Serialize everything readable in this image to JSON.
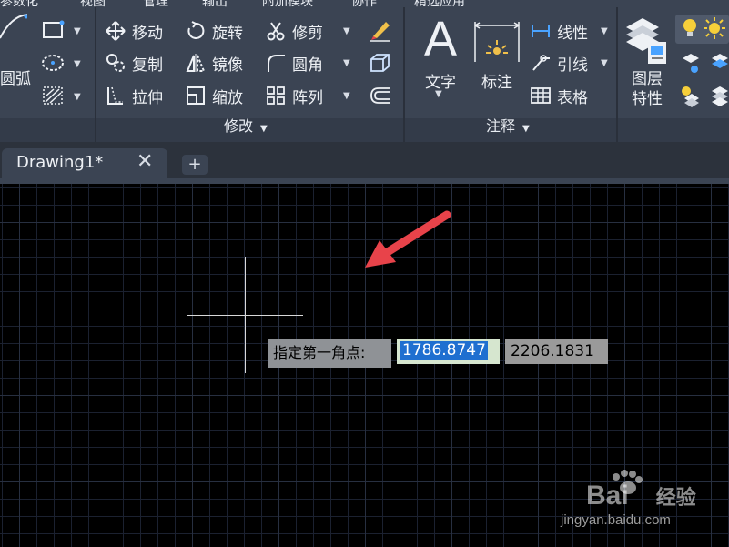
{
  "menu": {
    "items": [
      "参数化",
      "视图",
      "管理",
      "输出",
      "附加模块",
      "协作",
      "精选应用"
    ]
  },
  "ribbon": {
    "draw_panel": {
      "arc_label": "圆弧"
    },
    "modify_panel": {
      "title": "修改",
      "tools": [
        {
          "label": "移动",
          "icon": "move-icon"
        },
        {
          "label": "旋转",
          "icon": "rotate-icon"
        },
        {
          "label": "修剪",
          "icon": "trim-icon"
        },
        {
          "label": "复制",
          "icon": "copy-icon"
        },
        {
          "label": "镜像",
          "icon": "mirror-icon"
        },
        {
          "label": "圆角",
          "icon": "fillet-icon"
        },
        {
          "label": "拉伸",
          "icon": "stretch-icon"
        },
        {
          "label": "缩放",
          "icon": "scale-icon"
        },
        {
          "label": "阵列",
          "icon": "array-icon"
        }
      ]
    },
    "annotation_panel": {
      "title": "注释",
      "text_label": "文字",
      "dimension_label": "标注",
      "linear_label": "线性",
      "leader_label": "引线",
      "table_label": "表格"
    },
    "layers_panel": {
      "layer_properties_label": "图层\n特性",
      "line1": "图层",
      "line2": "特性"
    }
  },
  "tabs": {
    "document_tab": "Drawing1*",
    "close_symbol": "✕",
    "new_tab_symbol": "+"
  },
  "canvas": {
    "prompt": "指定第一角点:",
    "coord_x": "1786.8747",
    "coord_y": "2206.1831"
  },
  "watermark": {
    "brand": "Bai",
    "brand_suffix": "经验",
    "url": "jingyan.baidu.com"
  },
  "colors": {
    "ribbon_bg": "#3b4453",
    "canvas_bg": "#000000",
    "arrow_red": "#e8434a",
    "highlight_blue": "#1f6fd0"
  }
}
